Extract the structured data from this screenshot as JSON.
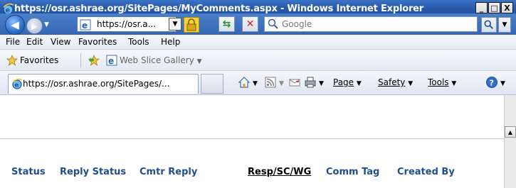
{
  "window": {
    "title": "https://osr.ashrae.org/SitePages/MyComments.aspx - Windows Internet Explorer",
    "minimize": "_",
    "maximize": "□",
    "close": "X"
  },
  "address": {
    "url": "https://osr.a...",
    "search_placeholder": "Google"
  },
  "menu": {
    "items": [
      "File",
      "Edit",
      "View",
      "Favorites",
      "Tools",
      "Help"
    ]
  },
  "favorites": {
    "label": "Favorites",
    "web_slice": "Web Slice Gallery"
  },
  "tab": {
    "label": "https://osr.ashrae.org/SitePages/..."
  },
  "commands": {
    "page": "Page",
    "safety": "Safety",
    "tools": "Tools"
  },
  "columns": {
    "status": "Status",
    "reply_status": "Reply Status",
    "cmtr_reply": "Cmtr Reply",
    "resp_sc_wg": "Resp/SC/WG",
    "comm_tag": "Comm Tag",
    "created_by": "Created By"
  }
}
